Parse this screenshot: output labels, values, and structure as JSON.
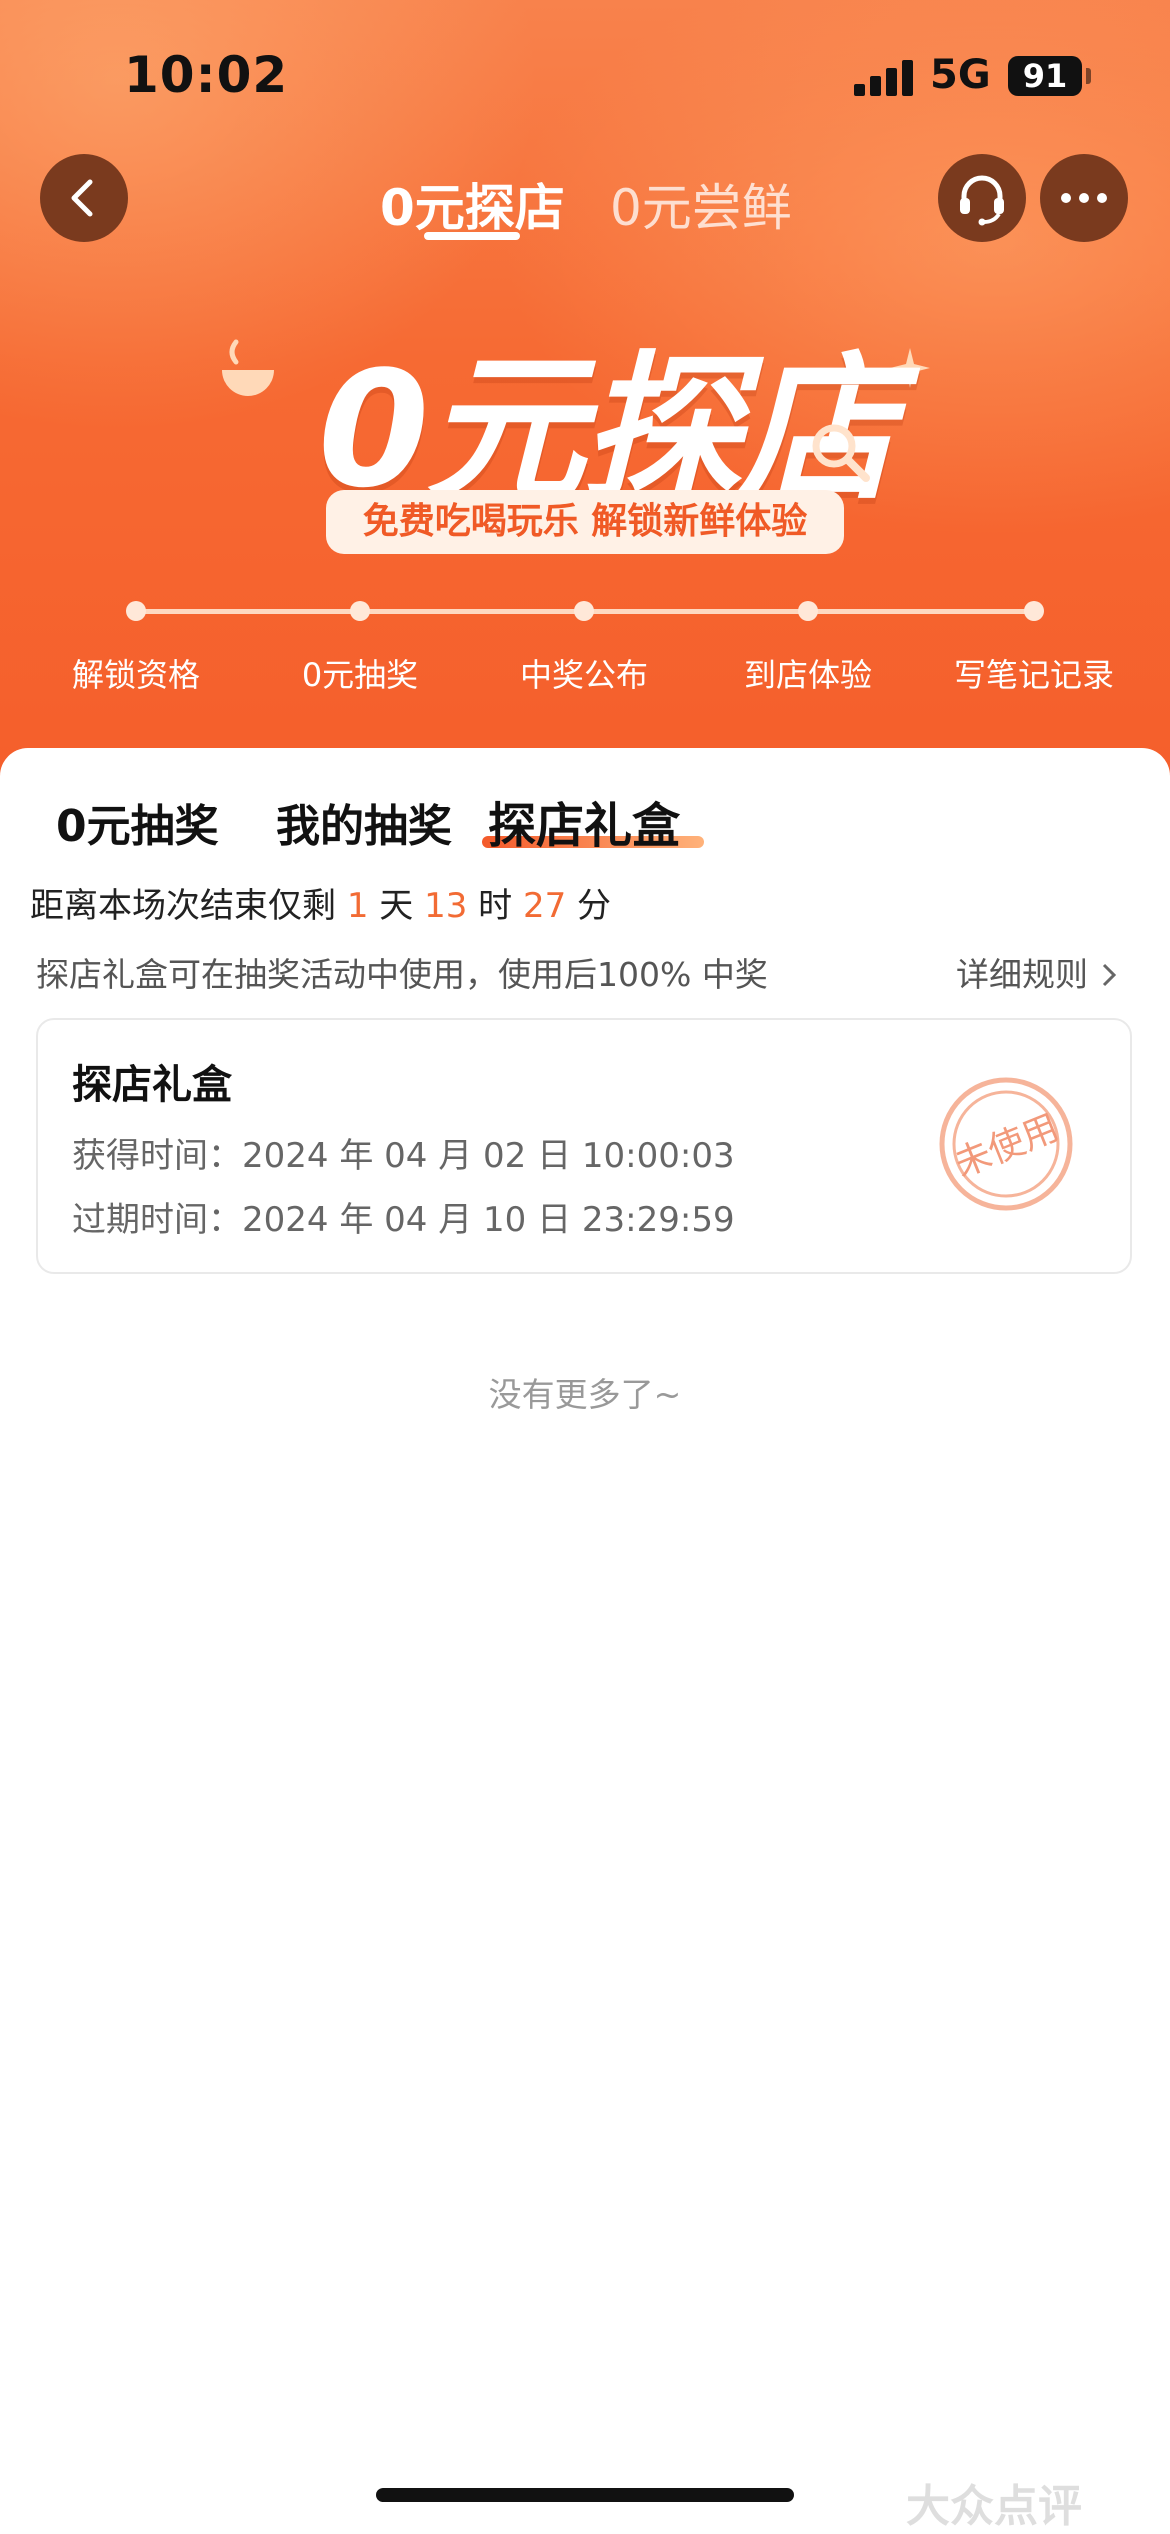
{
  "status_bar": {
    "time": "10:02",
    "network": "5G",
    "battery": "91"
  },
  "nav": {
    "tabs": [
      {
        "label": "0元探店",
        "active": true
      },
      {
        "label": "0元尝鲜",
        "active": false
      }
    ],
    "icons": [
      "chevron-left-icon",
      "headset-icon",
      "more-icon"
    ]
  },
  "hero": {
    "title": "0元探店",
    "subtitle": "免费吃喝玩乐 解锁新鲜体验",
    "steps": [
      "解锁资格",
      "0元抽奖",
      "中奖公布",
      "到店体验",
      "写笔记记录"
    ]
  },
  "content_tabs": [
    {
      "label": "0元抽奖",
      "active": false
    },
    {
      "label": "我的抽奖",
      "active": false
    },
    {
      "label": "探店礼盒",
      "active": true
    }
  ],
  "countdown": {
    "prefix": "距离本场次结束仅剩",
    "days": "1",
    "days_unit": "天",
    "hours": "13",
    "hours_unit": "时",
    "minutes": "27",
    "minutes_unit": "分"
  },
  "notice": {
    "text": "探店礼盒可在抽奖活动中使用，使用后100% 中奖",
    "rules_link": "详细规则"
  },
  "gift_box": {
    "title": "探店礼盒",
    "obtained_label": "获得时间：",
    "obtained_value": "2024 年 04 月 02 日  10:00:03",
    "expire_label": "过期时间：",
    "expire_value": "2024 年 04 月 10 日  23:29:59",
    "status_stamp": "未使用"
  },
  "list_end": "没有更多了~",
  "watermark": "大众点评",
  "colors": {
    "accent": "#f26b34",
    "hero": "#f66a33"
  }
}
